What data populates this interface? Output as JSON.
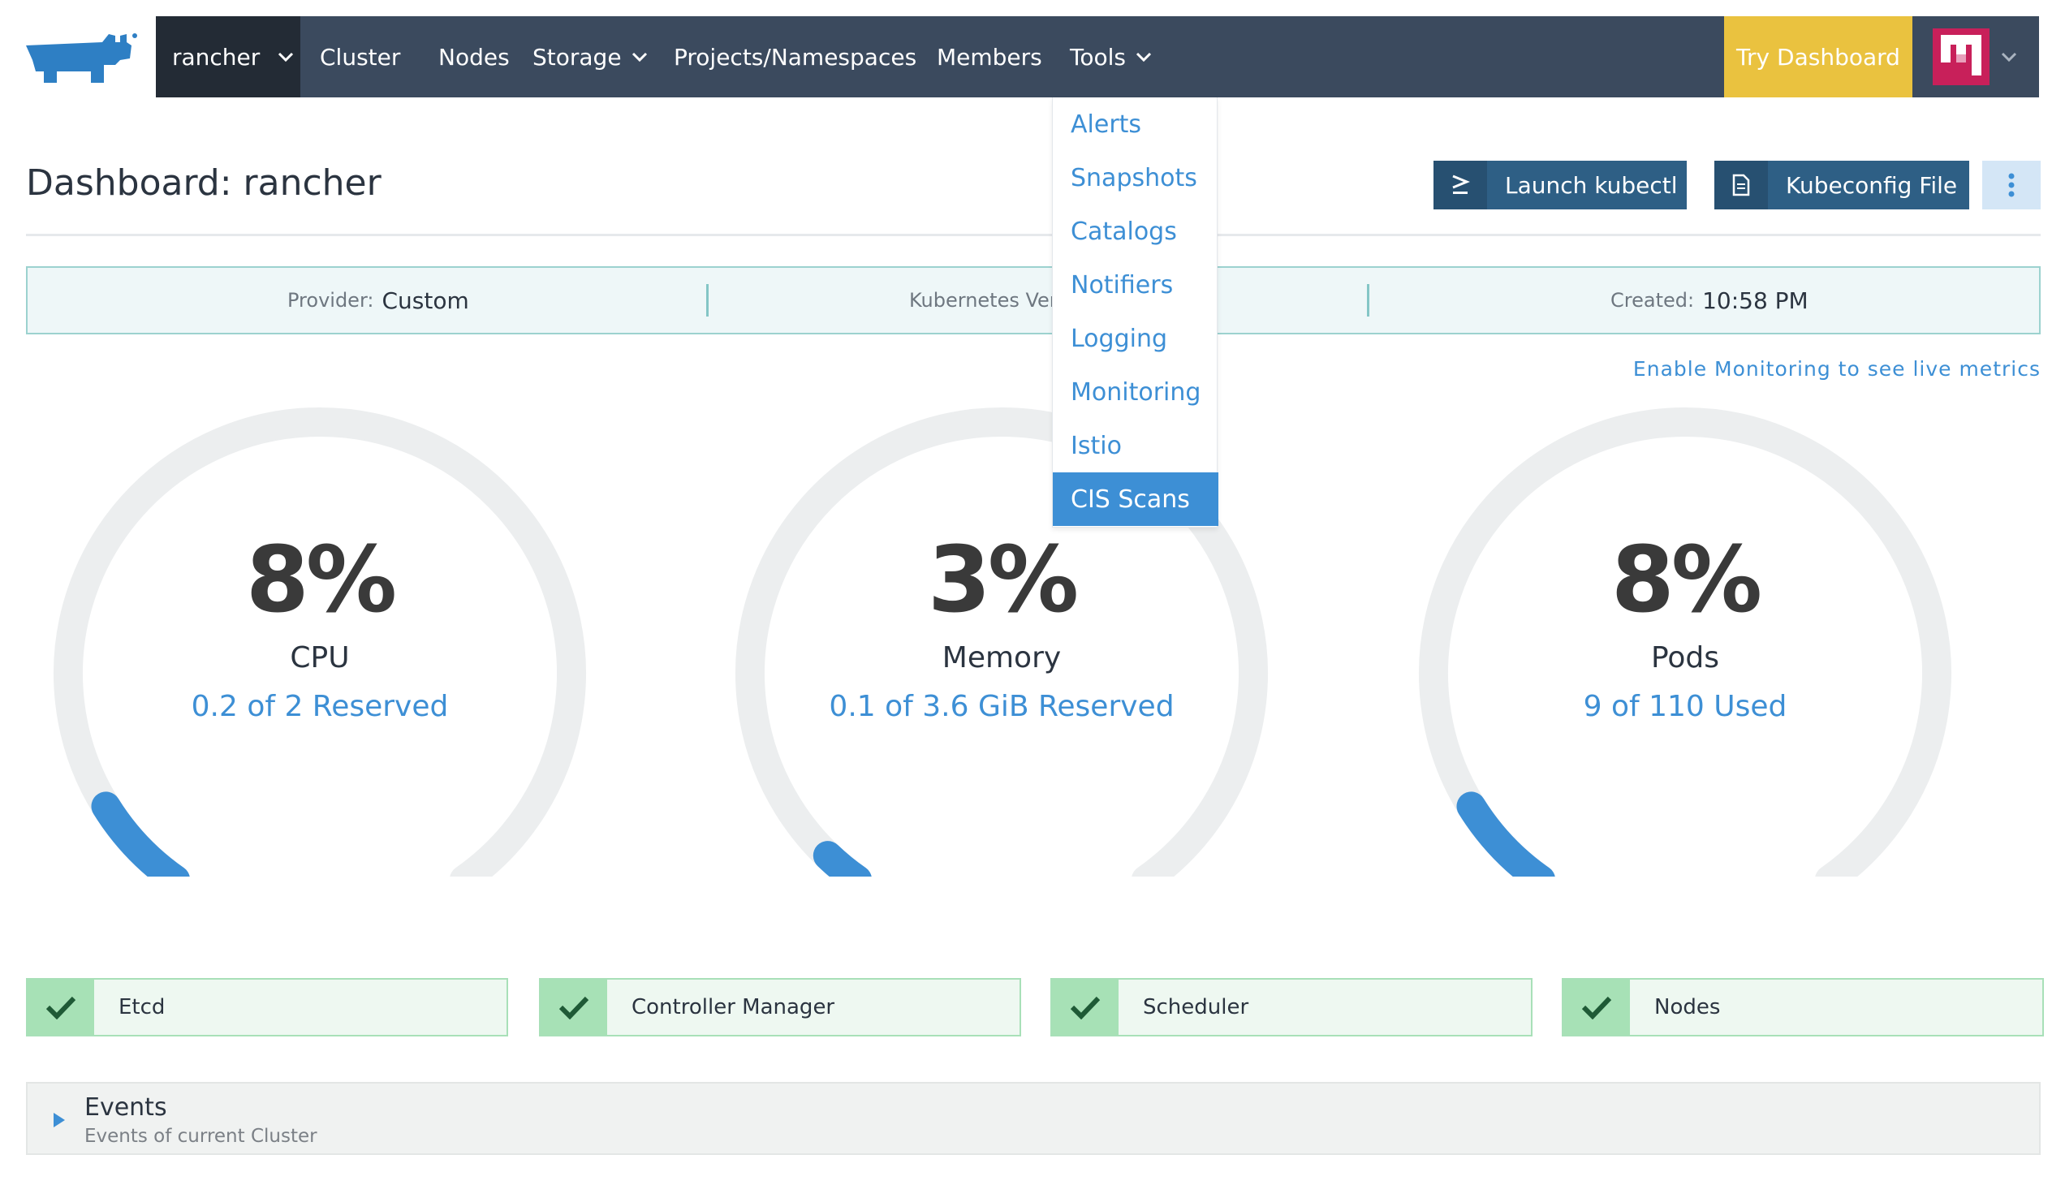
{
  "nav": {
    "cluster": "rancher",
    "items": [
      {
        "label": "Cluster"
      },
      {
        "label": "Nodes"
      },
      {
        "label": "Storage",
        "has_dropdown": true
      },
      {
        "label": "Projects/Namespaces"
      },
      {
        "label": "Members"
      },
      {
        "label": "Tools",
        "has_dropdown": true
      }
    ],
    "try_dashboard": "Try Dashboard"
  },
  "tools_menu": {
    "items": [
      {
        "label": "Alerts"
      },
      {
        "label": "Snapshots"
      },
      {
        "label": "Catalogs"
      },
      {
        "label": "Notifiers"
      },
      {
        "label": "Logging"
      },
      {
        "label": "Monitoring"
      },
      {
        "label": "Istio"
      },
      {
        "label": "CIS Scans",
        "active": true
      }
    ]
  },
  "page": {
    "title": "Dashboard: rancher",
    "launch_kubectl": "Launch kubectl",
    "kubeconfig_file": "Kubeconfig File"
  },
  "info": {
    "provider_label": "Provider:",
    "provider_value": "Custom",
    "kubernetes_label": "Kubernetes Ver",
    "created_label": "Created:",
    "created_value": "10:58 PM"
  },
  "monitoring_link": "Enable Monitoring to see live metrics",
  "gauges": [
    {
      "value": "8%",
      "label": "CPU",
      "sub": "0.2 of 2 Reserved",
      "fraction": 0.08
    },
    {
      "value": "3%",
      "label": "Memory",
      "sub": "0.1 of 3.6 GiB Reserved",
      "fraction": 0.03
    },
    {
      "value": "8%",
      "label": "Pods",
      "sub": "9 of 110 Used",
      "fraction": 0.08
    }
  ],
  "components": [
    {
      "label": "Etcd",
      "status": "ok"
    },
    {
      "label": "Controller Manager",
      "status": "ok"
    },
    {
      "label": "Scheduler",
      "status": "ok"
    },
    {
      "label": "Nodes",
      "status": "ok"
    }
  ],
  "events": {
    "title": "Events",
    "subtitle": "Events of current Cluster"
  },
  "colors": {
    "nav_bg": "#3b4a5e",
    "accent_blue": "#3d8fd5",
    "try_dashboard_bg": "#eac23f",
    "button_bg": "#2e5f85",
    "ok_green": "#a7e1b6",
    "avatar_pink": "#c8205a"
  }
}
